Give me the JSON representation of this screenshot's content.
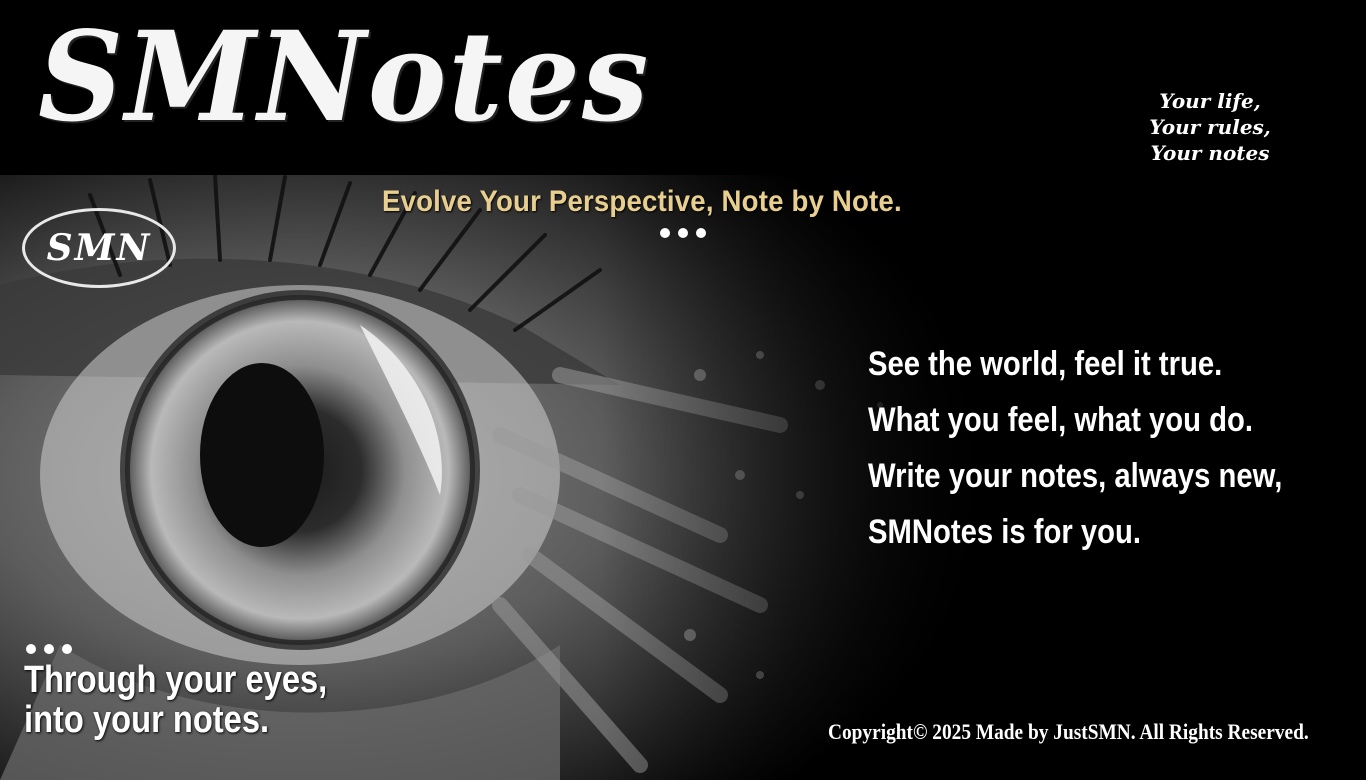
{
  "header": {
    "brand": "SMNotes",
    "tagline_lines": [
      "Your life,",
      "Your rules,",
      "Your notes"
    ]
  },
  "hero": {
    "badge": "SMN",
    "slogan": "Evolve Your Perspective, Note by Note.",
    "poem": [
      "See the world, feel it true.",
      "What you feel, what you do.",
      "Write your notes, always new,",
      "SMNotes is for you."
    ],
    "eyes_text": [
      "Through your eyes,",
      "into your notes."
    ],
    "image_icon": "eye-photo"
  },
  "footer": {
    "copyright": "Copyright© 2025 Made by JustSMN. All Rights Reserved."
  },
  "colors": {
    "background": "#000000",
    "slogan": "#e8cf8f",
    "text": "#ffffff"
  }
}
